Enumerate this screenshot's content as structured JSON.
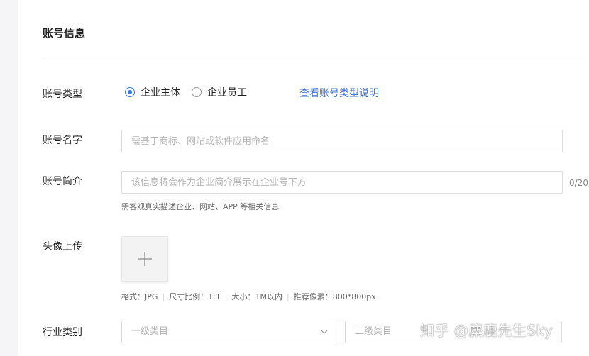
{
  "section": {
    "title": "账号信息"
  },
  "account_type": {
    "label": "账号类型",
    "options": [
      {
        "label": "企业主体",
        "checked": true
      },
      {
        "label": "企业员工",
        "checked": false
      }
    ],
    "link": "查看账号类型说明"
  },
  "account_name": {
    "label": "账号名字",
    "placeholder": "需基于商标、网站或软件应用命名"
  },
  "account_intro": {
    "label": "账号简介",
    "placeholder": "该信息将会作为企业简介展示在企业号下方",
    "counter": "0/20",
    "hint": "需客观真实描述企业、网站、APP 等相关信息"
  },
  "avatar": {
    "label": "头像上传",
    "plus_icon": "plus-icon",
    "specs": [
      "格式：JPG",
      "尺寸比例：1:1",
      "大小：1M以内",
      "推荐像素：800*800px"
    ]
  },
  "industry": {
    "label": "行业类别",
    "primary_placeholder": "一级类目",
    "secondary_placeholder": "二级类目"
  },
  "watermark": "知乎 @麋鹿先生Sky",
  "colors": {
    "accent": "#3a78e0",
    "link": "#3a73d8"
  }
}
